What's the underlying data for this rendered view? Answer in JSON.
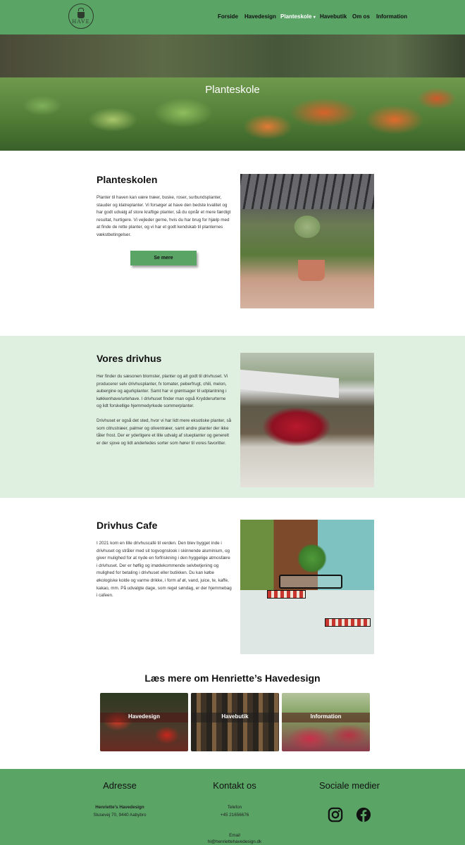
{
  "header": {
    "logo_text": "HAVE",
    "nav": [
      {
        "label": "Forside"
      },
      {
        "label": "Havedesign"
      },
      {
        "label": "Planteskole",
        "active": true,
        "caret": "▾"
      },
      {
        "label": "Havebutik"
      },
      {
        "label": "Om os"
      },
      {
        "label": "Information"
      }
    ]
  },
  "hero": {
    "title": "Planteskole"
  },
  "sections": [
    {
      "title": "Planteskolen",
      "paragraphs": [
        "Planter til haven kan være træer, buske, roser, surbundsplanter, stauder og klatreplanter. Vi forsøger at have den bedste kvalitet og har godt udvalg af store kraftige planter, så du opnår et mere færdigt resultat, hurtigere. Vi vejleder gerne, hvis du har brug for hjælp med at finde de rette planter, og vi har et godt kendskab til planternes vækstbetingelser."
      ],
      "button": "Se mere"
    },
    {
      "title": "Vores drivhus",
      "paragraphs": [
        "Her finder du sæsonen blomster, planter og alt godt til drivhuset. Vi producerer selv drivhusplanter, fx tomater, peberfrugt, chili, melon, aubergine og agurkplanter. Samt har vi grøntsager til udplantning i køkkenhave/urtehave. I drivhuset finder man også Krydderurterne og lidt forskellige hjemmedyrkede sommerplanter.",
        "Drivhuset er også det sted, hvor vi har lidt mere eksotiske planter, så som citrustræer, palmer og oliventræer, samt andre planter der ikke tåler frost. Der er yderligere et lille udvalg af stueplanter og generelt er der sjove og lidt anderledes sorter som hører til vores favoritter."
      ]
    },
    {
      "title": "Drivhus Cafe",
      "paragraphs": [
        "I 2021 kom en lille drivhuscafé til verden. Den blev bygget inde i drivhuset og stråler med sit togvognslook i skinnende aluminium, og giver mulighed for at nyde en forfriskning i den hyggelige atmosfære i drivhuset. Der er høflig og imødekommende selvbetjening og mulighed for betaling i drivhuset eller butikken. Du kan købe økologiske kolde og varme drikke, i form af øl, vand, juice, te, kaffe, kakao, mm. På udvalgte dage, som regel søndag, er der hjemmebag i cafeen."
      ]
    }
  ],
  "readmore": {
    "title": "Læs mere om Henriette’s Havedesign",
    "tiles": [
      {
        "label": "Havedesign"
      },
      {
        "label": "Havebutik"
      },
      {
        "label": "Information"
      }
    ]
  },
  "footer": {
    "address": {
      "heading": "Adresse",
      "name": "Henriette's Havedesign",
      "street": "Slusevej 70, 9440 Aabybro"
    },
    "contact": {
      "heading": "Kontakt os",
      "phone_label": "Telefon",
      "phone": "+45 21656676",
      "email_label": "Email",
      "email": "hi@henriettehavedesign.dk"
    },
    "social": {
      "heading": "Sociale medier",
      "icons": [
        "instagram-icon",
        "facebook-icon"
      ]
    }
  },
  "colors": {
    "brand_green": "#5aa466",
    "light_green_bg": "#dff0e0"
  }
}
